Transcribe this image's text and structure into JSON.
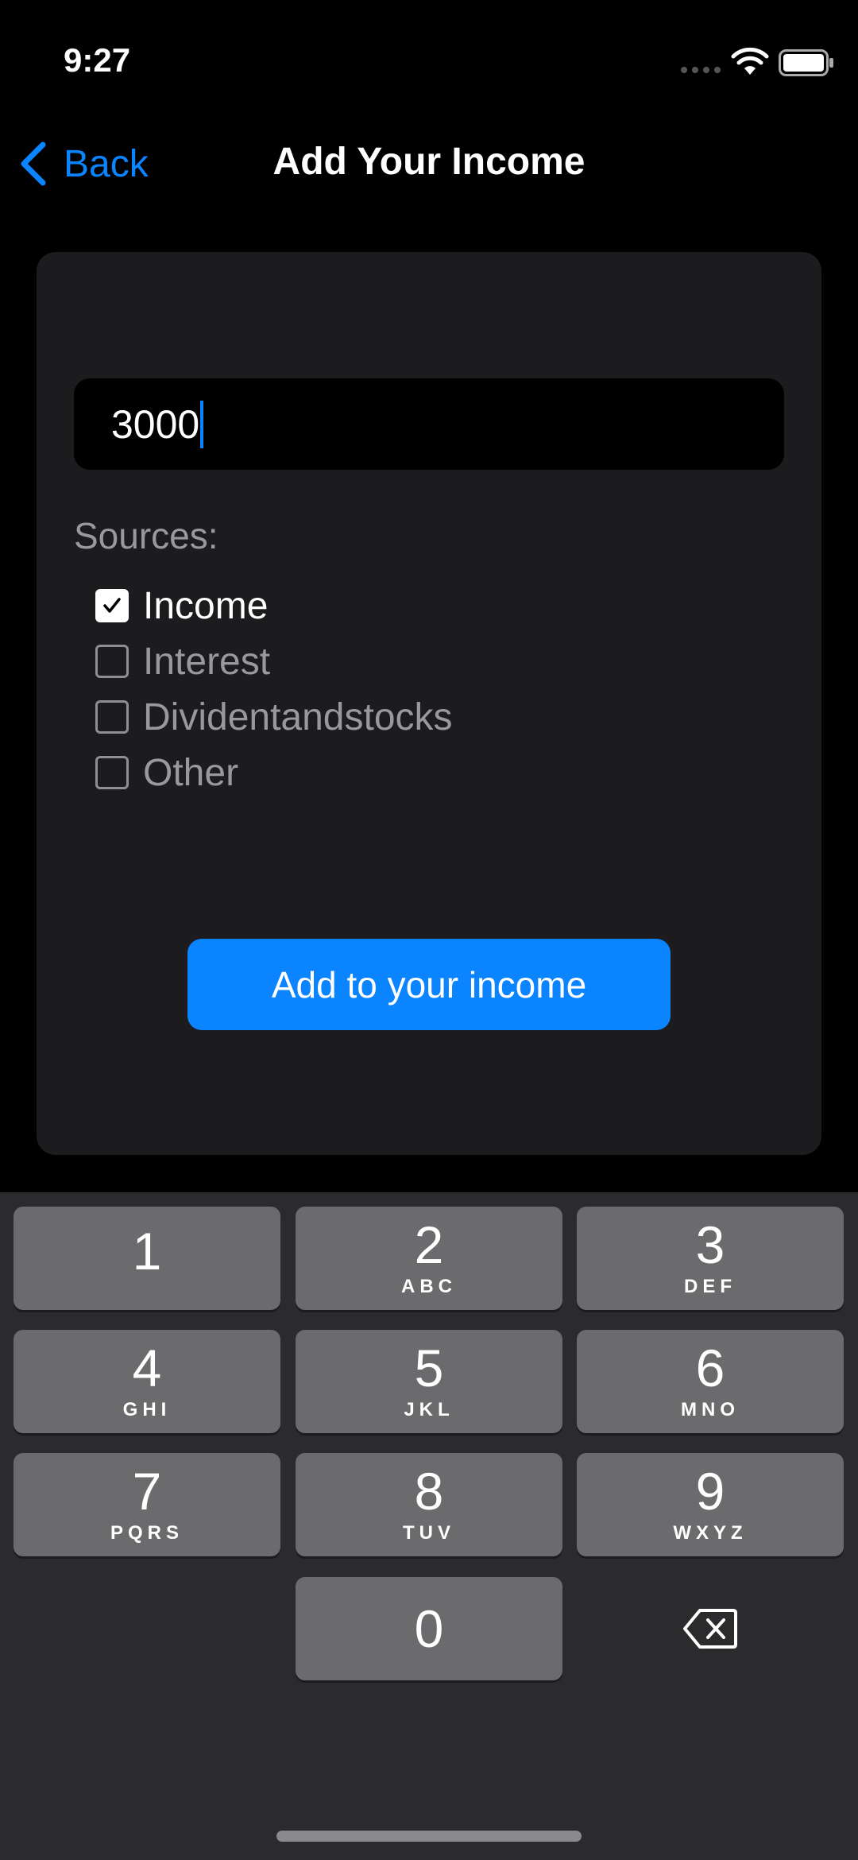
{
  "status_bar": {
    "time": "9:27",
    "icons": [
      "cellular-signal-icon",
      "wifi-icon",
      "battery-icon"
    ]
  },
  "nav": {
    "back_label": "Back",
    "title": "Add Your Income"
  },
  "form": {
    "amount_value": "3000",
    "sources_label": "Sources:",
    "sources": [
      {
        "label": "Income",
        "checked": true
      },
      {
        "label": "Interest",
        "checked": false
      },
      {
        "label": "Dividentandstocks",
        "checked": false
      },
      {
        "label": "Other",
        "checked": false
      }
    ],
    "submit_label": "Add to your income"
  },
  "keyboard": {
    "keys": [
      {
        "digit": "1",
        "letters": ""
      },
      {
        "digit": "2",
        "letters": "ABC"
      },
      {
        "digit": "3",
        "letters": "DEF"
      },
      {
        "digit": "4",
        "letters": "GHI"
      },
      {
        "digit": "5",
        "letters": "JKL"
      },
      {
        "digit": "6",
        "letters": "MNO"
      },
      {
        "digit": "7",
        "letters": "PQRS"
      },
      {
        "digit": "8",
        "letters": "TUV"
      },
      {
        "digit": "9",
        "letters": "WXYZ"
      },
      {
        "digit": "0",
        "letters": ""
      }
    ],
    "delete_icon": "backspace-icon"
  },
  "colors": {
    "accent": "#0a84ff",
    "background": "#000000",
    "card": "#1c1c1e",
    "keyboard": "#2b2b2d",
    "key": "#6b6b6d",
    "secondary_text": "#98989d"
  }
}
